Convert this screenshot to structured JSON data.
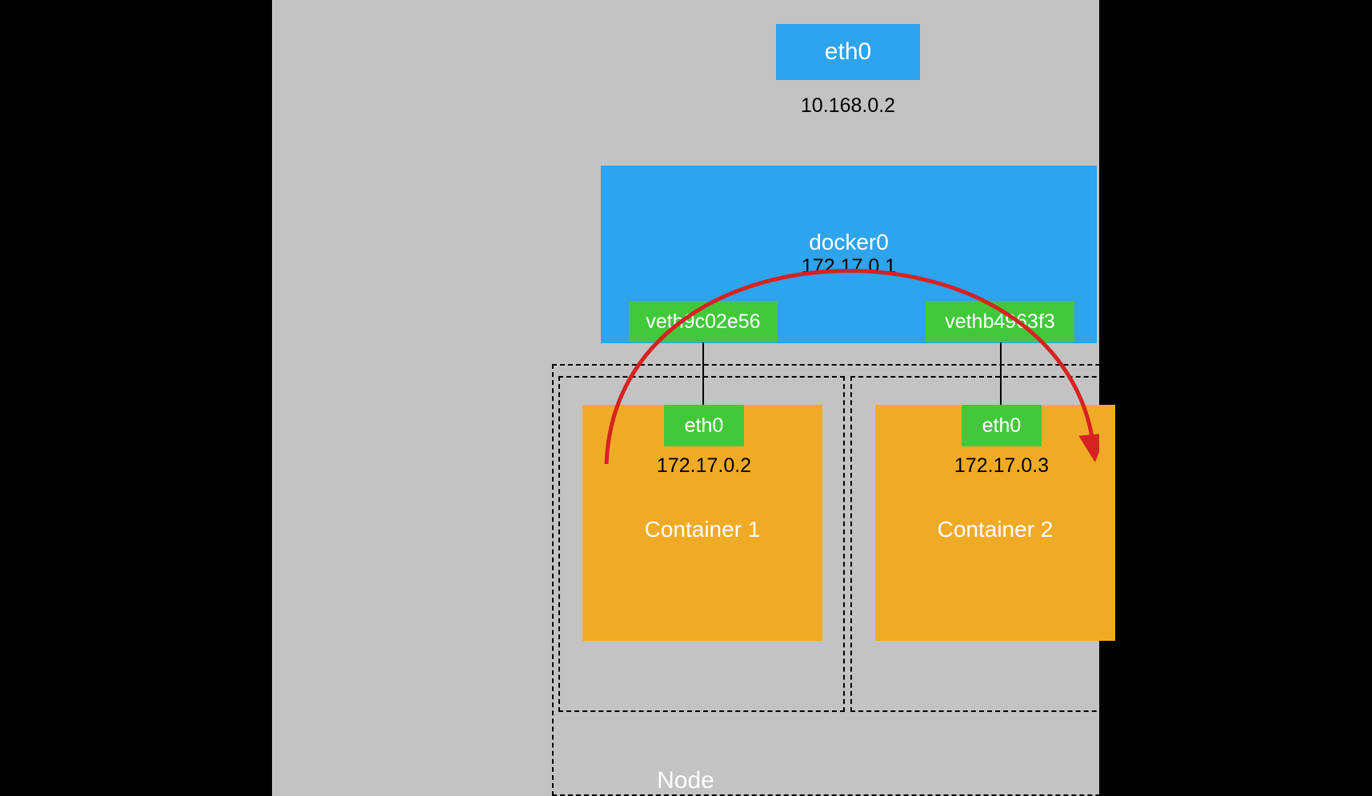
{
  "node": {
    "label": "Node"
  },
  "host_iface": {
    "name": "eth0",
    "ip": "10.168.0.2"
  },
  "bridge": {
    "name": "docker0",
    "ip": "172.17.0.1",
    "veths": [
      {
        "name": "veth9c02e56"
      },
      {
        "name": "vethb4963f3"
      }
    ]
  },
  "containers": [
    {
      "label": "Container 1",
      "iface": "eth0",
      "ip": "172.17.0.2"
    },
    {
      "label": "Container  2",
      "iface": "eth0",
      "ip": "172.17.0.3"
    }
  ]
}
